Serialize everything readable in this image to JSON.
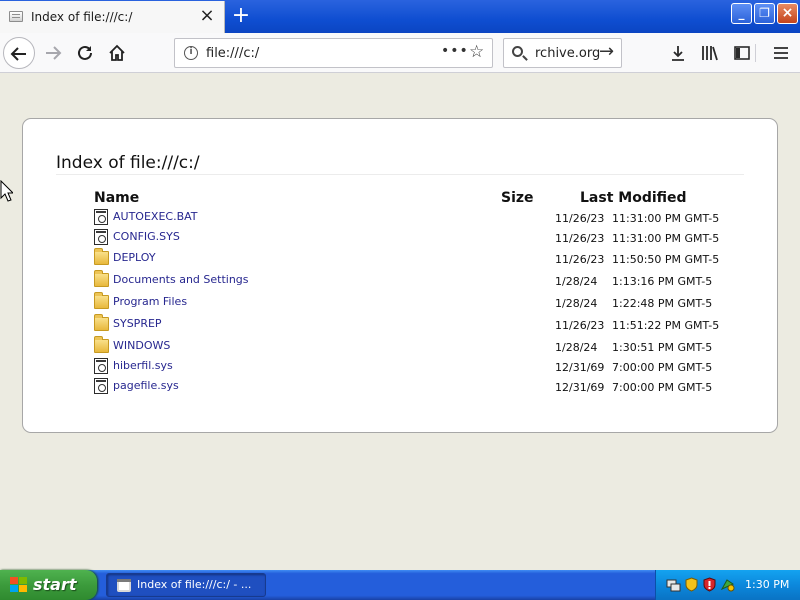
{
  "browser": {
    "tab_title": "Index of file:///c:/",
    "url": "file:///c:/",
    "search_text": "rchive.org"
  },
  "page": {
    "heading": "Index of file:///c:/",
    "columns": {
      "name": "Name",
      "size": "Size",
      "modified": "Last Modified"
    },
    "rows": [
      {
        "name": "AUTOEXEC.BAT",
        "type": "file",
        "size": "",
        "date": "11/26/23",
        "time": "11:31:00 PM GMT-5"
      },
      {
        "name": "CONFIG.SYS",
        "type": "file",
        "size": "",
        "date": "11/26/23",
        "time": "11:31:00 PM GMT-5"
      },
      {
        "name": "DEPLOY",
        "type": "folder",
        "size": "",
        "date": "11/26/23",
        "time": "11:50:50 PM GMT-5"
      },
      {
        "name": "Documents and Settings",
        "type": "folder",
        "size": "",
        "date": "1/28/24",
        "time": "1:13:16 PM GMT-5"
      },
      {
        "name": "Program Files",
        "type": "folder",
        "size": "",
        "date": "1/28/24",
        "time": "1:22:48 PM GMT-5"
      },
      {
        "name": "SYSPREP",
        "type": "folder",
        "size": "",
        "date": "11/26/23",
        "time": "11:51:22 PM GMT-5"
      },
      {
        "name": "WINDOWS",
        "type": "folder",
        "size": "",
        "date": "1/28/24",
        "time": "1:30:51 PM GMT-5"
      },
      {
        "name": "hiberfil.sys",
        "type": "file",
        "size": "",
        "date": "12/31/69",
        "time": "7:00:00 PM GMT-5"
      },
      {
        "name": "pagefile.sys",
        "type": "file",
        "size": "",
        "date": "12/31/69",
        "time": "7:00:00 PM GMT-5"
      }
    ]
  },
  "taskbar": {
    "start_label": "start",
    "task_label": "Index of file:///c:/ - ...",
    "clock": "1:30 PM"
  },
  "icons": {
    "file": "document-icon",
    "folder": "folder-icon"
  },
  "colors": {
    "link": "#27278f",
    "taskbar": "#245edb",
    "start_button": "#3c9b3c",
    "content_bg": "#ecebe1"
  }
}
